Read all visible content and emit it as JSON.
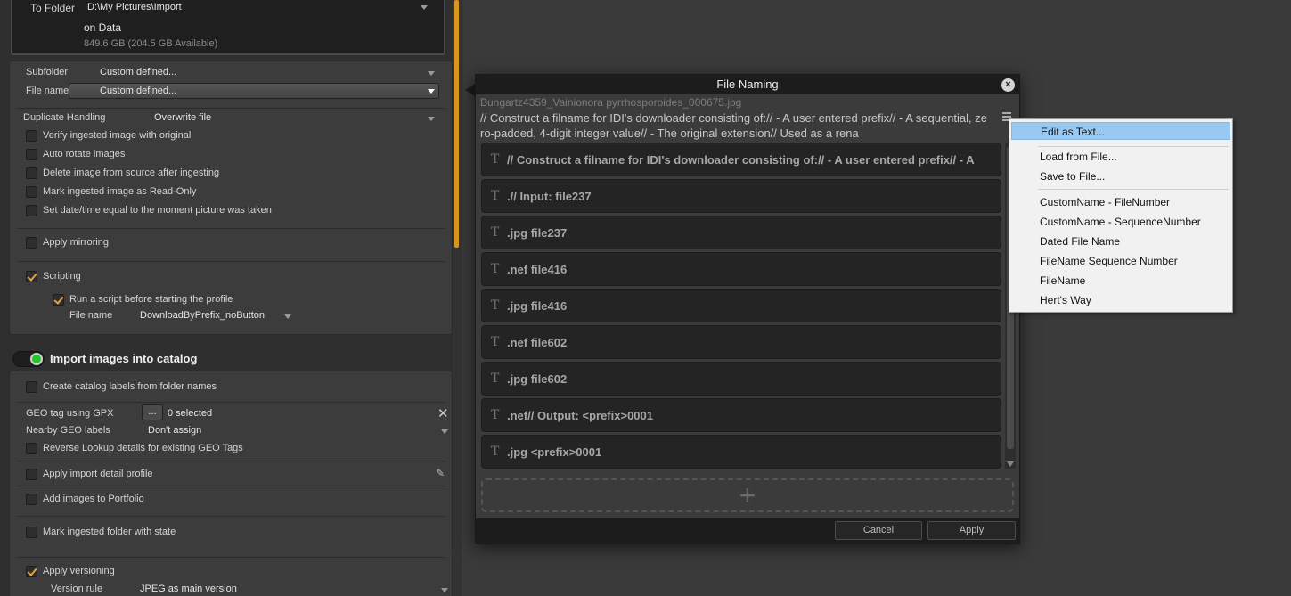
{
  "import_panel": {
    "to_folder_label": "To Folder",
    "to_folder_value": "D:\\My Pictures\\Import",
    "on_drive": "on Data",
    "space_info": "849.6 GB (204.5 GB Available)",
    "subfolder_label": "Subfolder",
    "subfolder_value": "Custom defined...",
    "filename_label": "File name",
    "filename_value": "Custom defined...",
    "duplicate_label": "Duplicate Handling",
    "duplicate_value": "Overwrite file",
    "options": [
      {
        "label": "Verify ingested image with original",
        "checked": false
      },
      {
        "label": "Auto rotate images",
        "checked": false
      },
      {
        "label": "Delete image from source after ingesting",
        "checked": false
      },
      {
        "label": "Mark ingested image as Read-Only",
        "checked": false
      },
      {
        "label": "Set date/time equal to the moment picture was taken",
        "checked": false
      }
    ],
    "apply_mirroring": "Apply mirroring",
    "scripting": "Scripting",
    "run_script": "Run a script before starting the profile",
    "script_file_label": "File name",
    "script_file_value": "DownloadByPrefix_noButton"
  },
  "catalog_panel": {
    "header": "Import images into catalog",
    "create_labels": "Create catalog labels from folder names",
    "geo_label": "GEO tag using GPX",
    "geo_button": "...",
    "geo_selected": "0 selected",
    "nearby_label": "Nearby GEO labels",
    "nearby_value": "Don't assign",
    "reverse_lookup": "Reverse Lookup details for existing GEO Tags",
    "apply_profile": "Apply import detail profile",
    "add_portfolio": "Add images to Portfolio",
    "mark_folder": "Mark ingested folder with state",
    "apply_versioning": "Apply versioning",
    "version_rule_label": "Version rule",
    "version_rule_value": "JPEG as main version"
  },
  "dialog": {
    "title": "File Naming",
    "close": "×",
    "sample_file": "Bungartz4359_Vainionora pyrrhosporoides_000675.jpg",
    "script_text": "// Construct a filname for IDI's downloader consisting of://   - A user entered prefix//   - A sequential, zero-padded, 4-digit integer value//   - The original extension// Used as a rena",
    "token_icon": "T",
    "tokens": [
      "// Construct a filname for IDI's downloader consisting of://   - A user entered prefix//   - A",
      ".// Input: file237",
      ".jpg file237",
      ".nef file416",
      ".jpg file416",
      ".nef file602",
      ".jpg file602",
      ".nef// Output: <prefix>0001",
      ".jpg <prefix>0001"
    ],
    "add_symbol": "+",
    "cancel": "Cancel",
    "apply": "Apply"
  },
  "menu": {
    "items": [
      "Edit as Text...",
      "Load from File...",
      "Save to File...",
      "CustomName - FileNumber",
      "CustomName - SequenceNumber",
      "Dated File Name",
      "FileName Sequence Number",
      "FileName",
      "Hert's Way"
    ]
  }
}
